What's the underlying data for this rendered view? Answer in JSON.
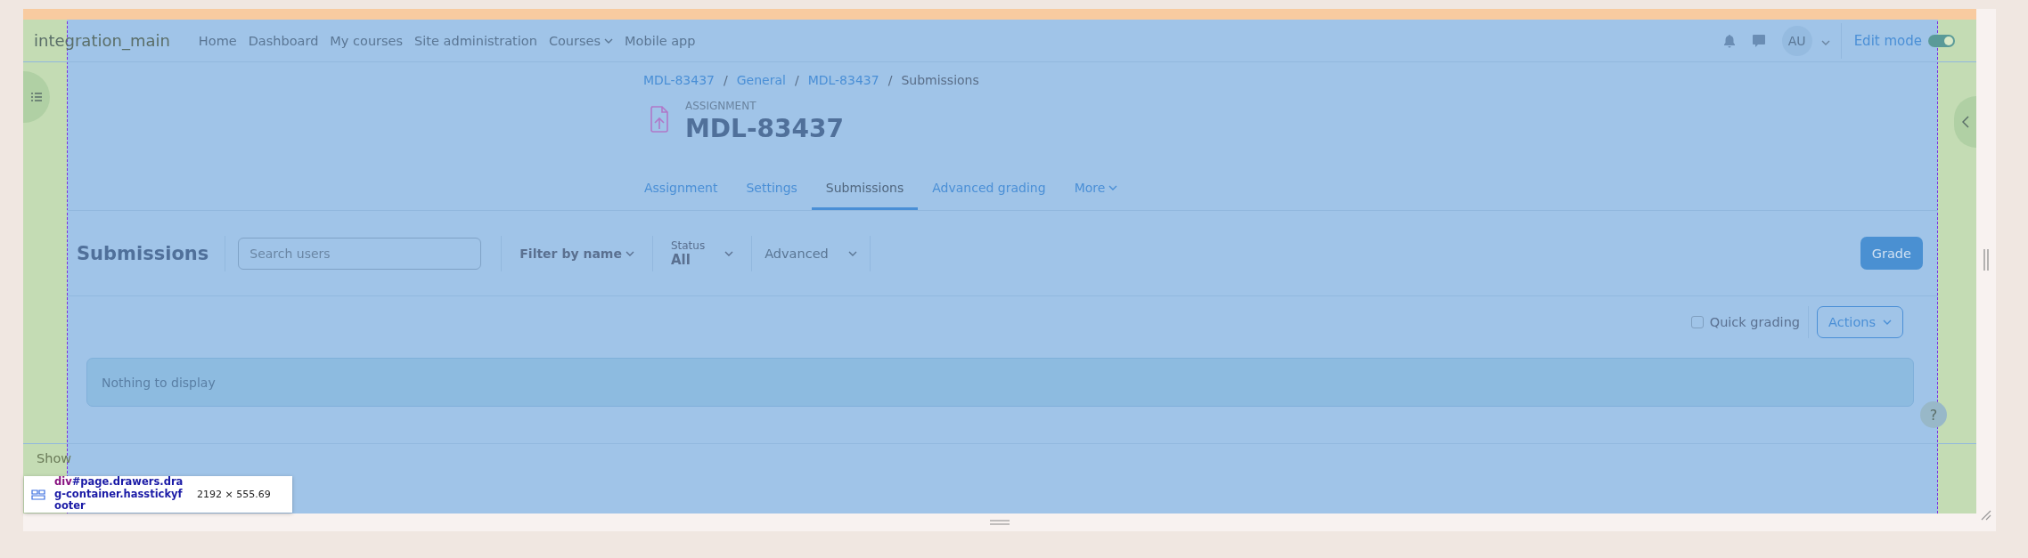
{
  "site_name": "integration_main",
  "nav_links": [
    {
      "label": "Home",
      "dropdown": false
    },
    {
      "label": "Dashboard",
      "dropdown": false
    },
    {
      "label": "My courses",
      "dropdown": false
    },
    {
      "label": "Site administration",
      "dropdown": false
    },
    {
      "label": "Courses",
      "dropdown": true
    },
    {
      "label": "Mobile app",
      "dropdown": false
    }
  ],
  "user": {
    "initials": "AU"
  },
  "edit_mode": {
    "label": "Edit mode",
    "on": true
  },
  "breadcrumb_separator": "/",
  "breadcrumb": [
    {
      "label": "MDL-83437",
      "link": true
    },
    {
      "label": "General",
      "link": true
    },
    {
      "label": "MDL-83437",
      "link": true
    },
    {
      "label": "Submissions",
      "link": false
    }
  ],
  "help_button": "?",
  "activity": {
    "type_label": "ASSIGNMENT",
    "title": "MDL-83437"
  },
  "tabs": [
    {
      "label": "Assignment",
      "selected": false,
      "dropdown": false
    },
    {
      "label": "Settings",
      "selected": false,
      "dropdown": false
    },
    {
      "label": "Submissions",
      "selected": true,
      "dropdown": false
    },
    {
      "label": "Advanced grading",
      "selected": false,
      "dropdown": false
    },
    {
      "label": "More",
      "selected": false,
      "dropdown": true
    }
  ],
  "submissions_bar": {
    "heading": "Submissions",
    "search": {
      "placeholder": "Search users"
    },
    "filter_by_name": "Filter by name",
    "status": {
      "label": "Status",
      "value": "All"
    },
    "advanced": "Advanced",
    "grade_button": "Grade"
  },
  "quick_grading": {
    "label": "Quick grading",
    "checked": false
  },
  "actions_button": "Actions",
  "empty_message": "Nothing to display",
  "footer": {
    "show_label": "Show"
  },
  "devtools_tooltip": {
    "tag": "div",
    "selector": "#page.drawers.drag-container.hasstickyfooter",
    "size": "2192 × 555.69"
  }
}
